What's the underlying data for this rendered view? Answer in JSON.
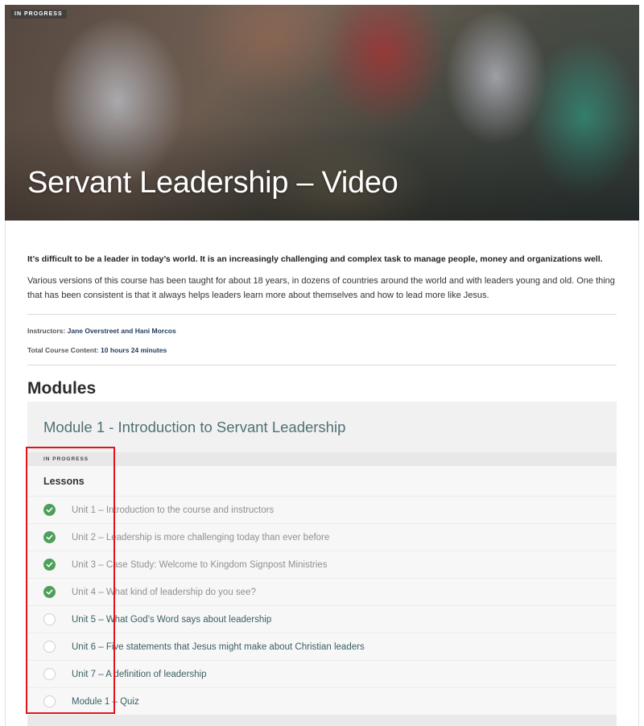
{
  "hero": {
    "status_badge": "IN PROGRESS",
    "title": "Servant Leadership – Video"
  },
  "course": {
    "lead": "It’s difficult to be a leader in today’s world. It is an increasingly challenging and complex task to manage people, money and organizations well.",
    "description": "Various versions of this course has been taught for about 18 years, in dozens of countries around the world and with leaders young and old. One thing that has been consistent is that it always helps leaders learn more about themselves and how to lead more like Jesus.",
    "instructors_label": "Instructors:",
    "instructors_value": "Jane Overstreet and Hani Morcos",
    "content_label": "Total Course Content:",
    "content_value": "10 hours 24 minutes"
  },
  "modules_heading": "Modules",
  "module": {
    "title": "Module 1 - Introduction to Servant Leadership",
    "status": "IN PROGRESS",
    "lessons_heading": "Lessons",
    "lessons": [
      {
        "label": "Unit 1 – Introduction to the course and instructors",
        "completed": true
      },
      {
        "label": "Unit 2 – Leadership is more challenging today than ever before",
        "completed": true
      },
      {
        "label": "Unit 3 – Case Study: Welcome to Kingdom Signpost Ministries",
        "completed": true
      },
      {
        "label": "Unit 4 – What kind of leadership do you see?",
        "completed": true
      },
      {
        "label": "Unit 5 – What God’s Word says about leadership",
        "completed": false
      },
      {
        "label": "Unit 6 – Five statements that Jesus might make about Christian leaders",
        "completed": false
      },
      {
        "label": "Unit 7 – A definition of leadership",
        "completed": false
      },
      {
        "label": "Module 1 – Quiz",
        "completed": false
      }
    ]
  },
  "colors": {
    "accent_teal": "#4e7174",
    "check_green": "#4f9f5b",
    "highlight_red": "#e0141c"
  },
  "icons": {
    "completed": "check-circle-icon",
    "incomplete": "empty-circle-icon"
  }
}
